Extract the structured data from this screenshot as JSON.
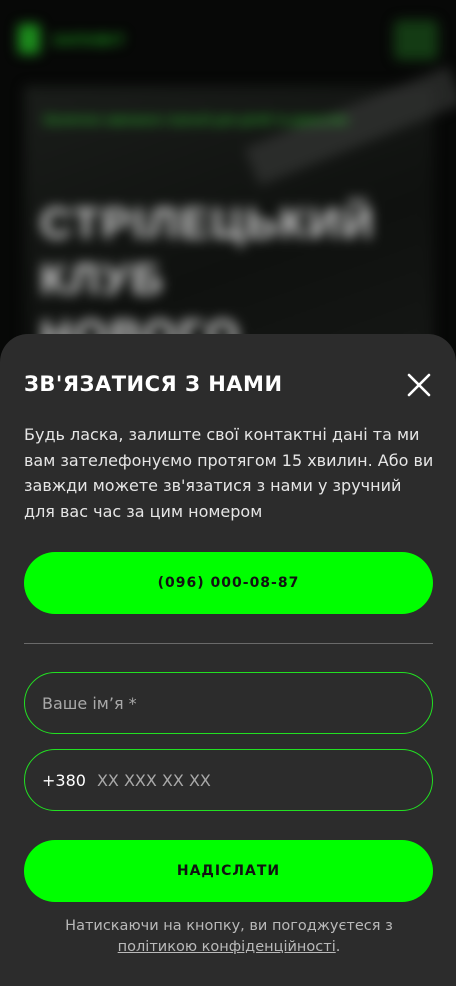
{
  "background": {
    "logo_text": "ЗАПОВІТ",
    "subtitle": "Безпечне навчання стрільбі для дітей та дорослих",
    "title": "Стрілецький клуб нового покоління"
  },
  "modal": {
    "title": "ЗВ'ЯЗАТИСЯ З НАМИ",
    "description": "Будь ласка, залиште свої контактні дані та ми вам зателефонуємо протягом 15 хвилин. Або ви завжди можете зв'язатися з нами у зручний для вас час за цим номером",
    "phone_button_label": "(096) 000-08-87",
    "name_placeholder": "Ваше ім’я *",
    "phone_prefix": "+380",
    "phone_placeholder": "XX XXX XX XX",
    "submit_label": "НАДІСЛАТИ",
    "consent_text": "Натискаючи на кнопку, ви погоджуєтеся з ",
    "consent_link": "політикою конфіденційності",
    "consent_end": "."
  },
  "colors": {
    "accent": "#00ff00",
    "sheet_bg": "#2c2c2c",
    "field_border": "#22e022"
  },
  "icons": {
    "close": "close-icon"
  }
}
